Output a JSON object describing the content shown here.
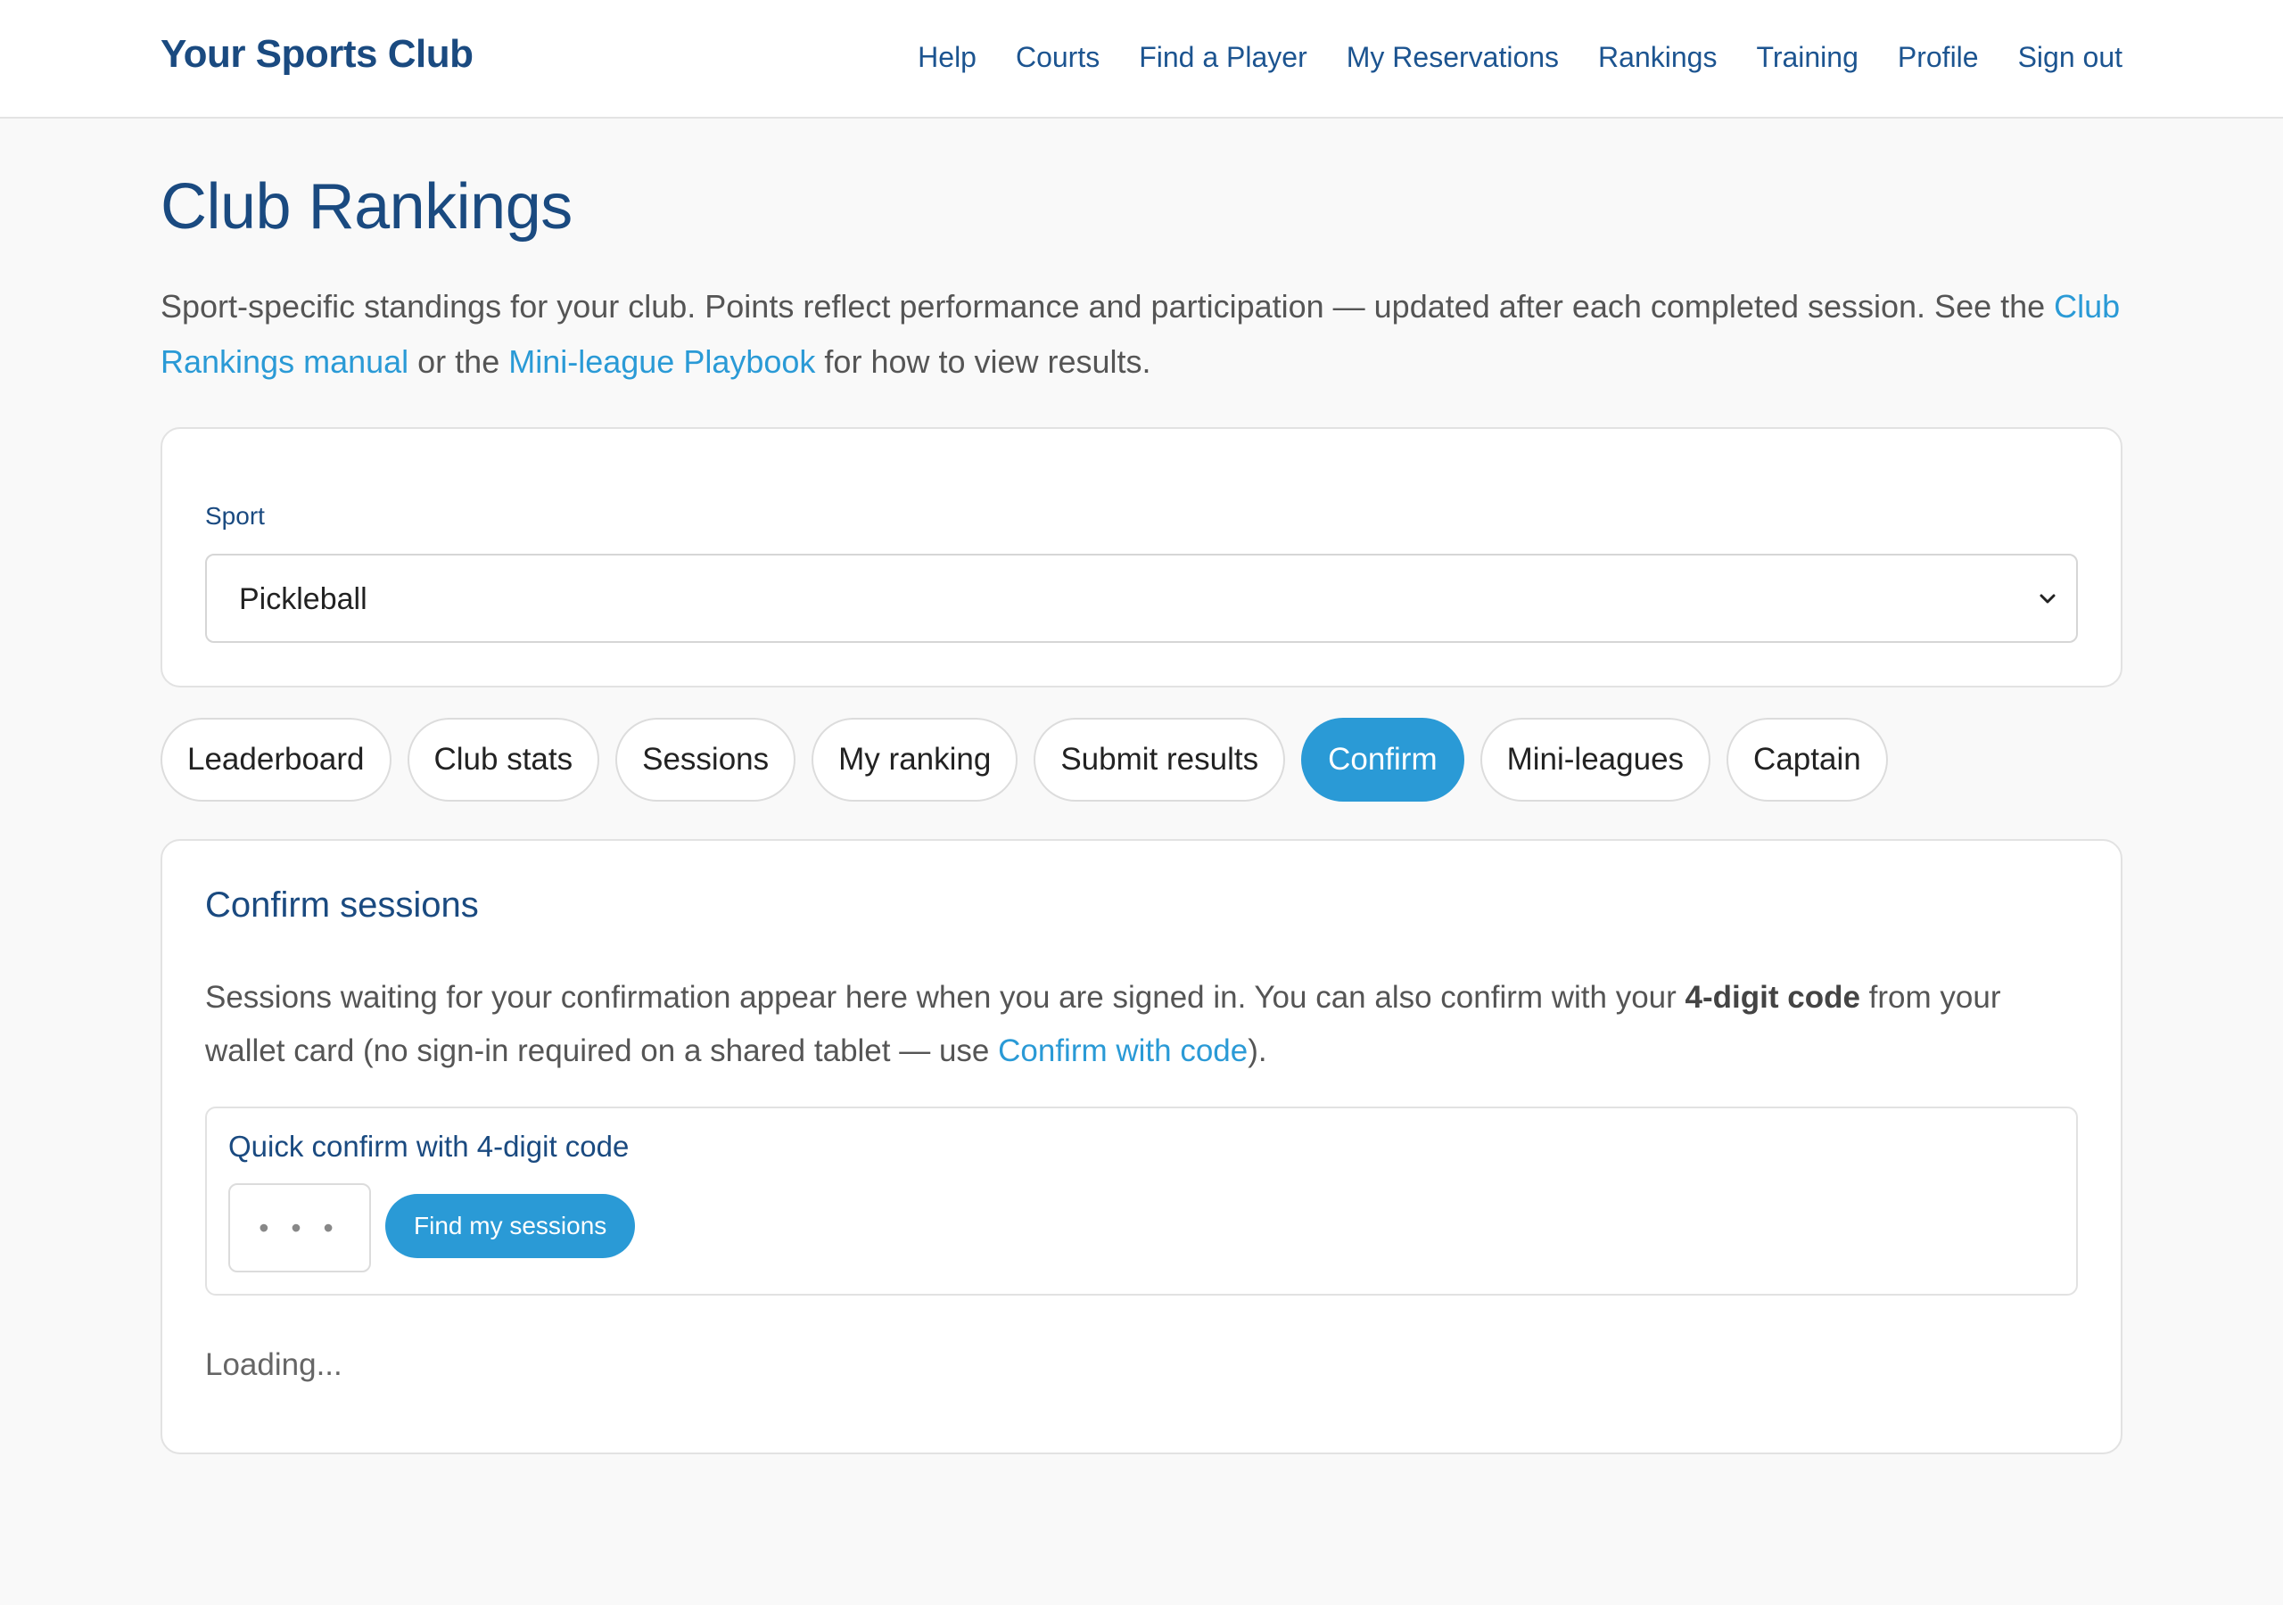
{
  "header": {
    "brand": "Your Sports Club",
    "nav": [
      "Help",
      "Courts",
      "Find a Player",
      "My Reservations",
      "Rankings",
      "Training",
      "Profile",
      "Sign out"
    ]
  },
  "page": {
    "title": "Club Rankings",
    "intro_text_1": "Sport-specific standings for your club. Points reflect performance and participation — updated after each completed session. See the ",
    "intro_link_1": "Club Rankings manual",
    "intro_text_2": " or the ",
    "intro_link_2": "Mini-league Playbook",
    "intro_text_3": " for how to view results."
  },
  "sport": {
    "label": "Sport",
    "selected": "Pickleball"
  },
  "tabs": [
    "Leaderboard",
    "Club stats",
    "Sessions",
    "My ranking",
    "Submit results",
    "Confirm",
    "Mini-leagues",
    "Captain"
  ],
  "active_tab": "Confirm",
  "confirm": {
    "title": "Confirm sessions",
    "text_1": "Sessions waiting for your confirmation appear here when you are signed in. You can also confirm with your ",
    "text_bold": "4-digit code",
    "text_2": " from your wallet card (no sign-in required on a shared tablet — use ",
    "text_link": "Confirm with code",
    "text_3": ").",
    "quick_title": "Quick confirm with 4-digit code",
    "code_placeholder": "• • •",
    "find_button": "Find my sessions",
    "loading": "Loading..."
  },
  "colors": {
    "brand": "#1a4a80",
    "accent": "#2a9ad6"
  }
}
